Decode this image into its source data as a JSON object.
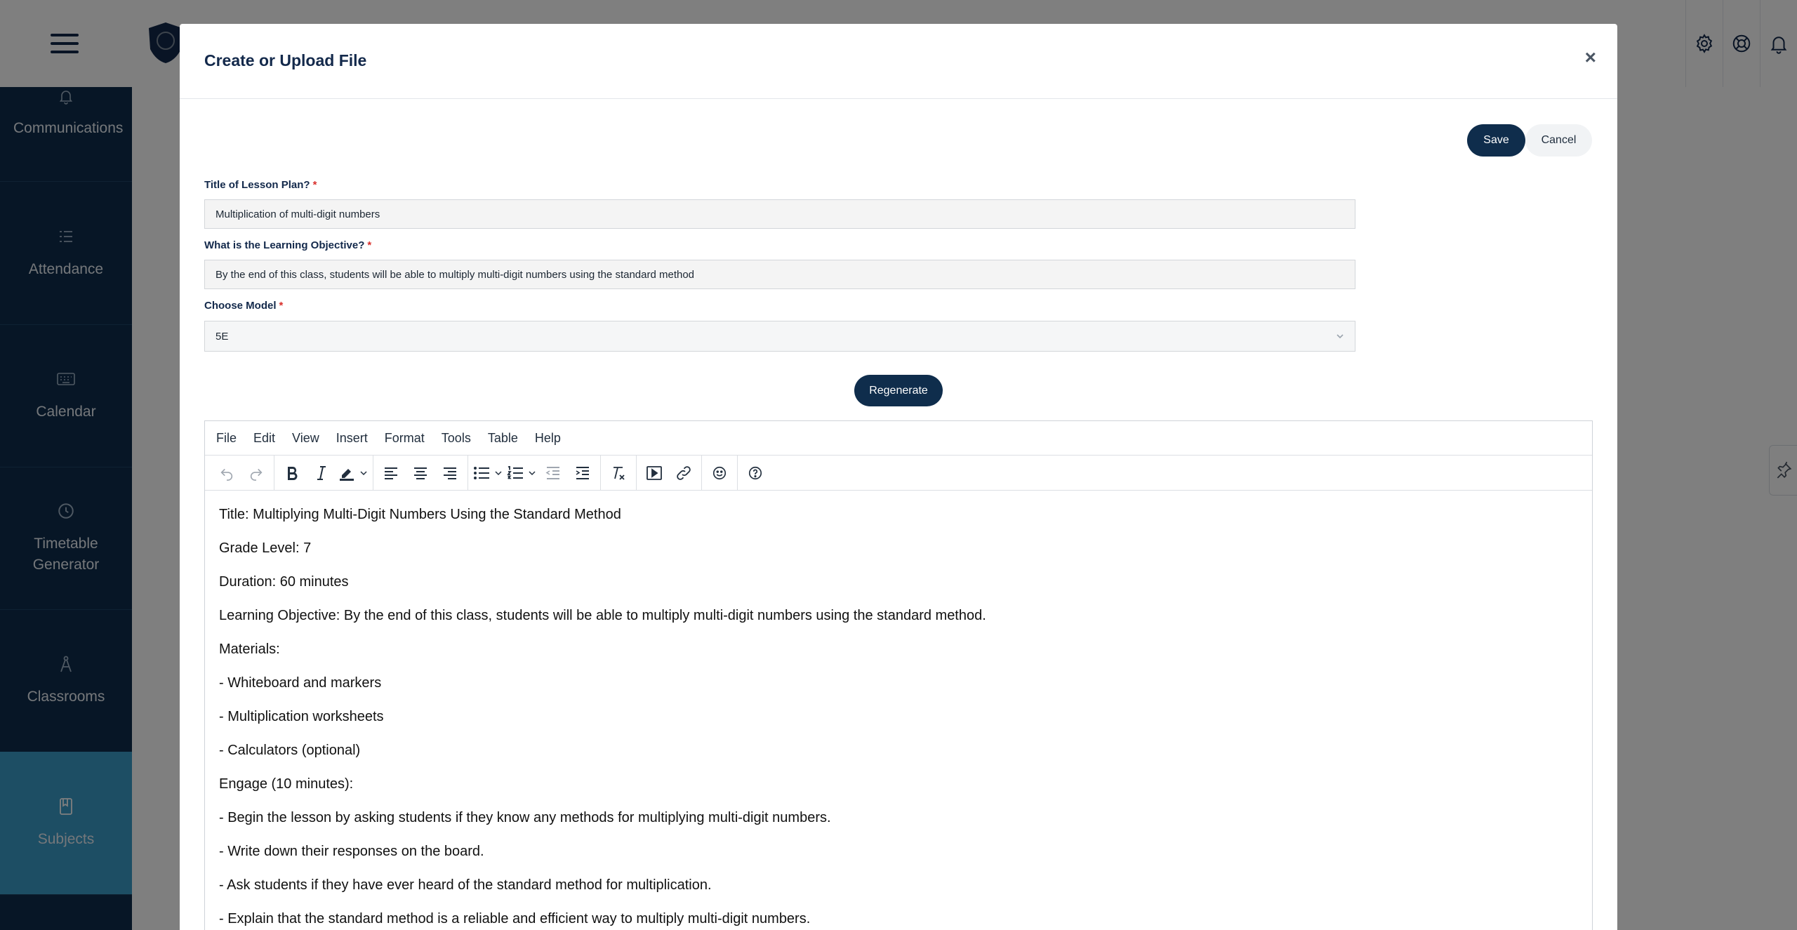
{
  "sidebar": {
    "items": [
      {
        "label": "Communications",
        "icon": "bell-icon"
      },
      {
        "label": "Attendance",
        "icon": "checklist-icon"
      },
      {
        "label": "Calendar",
        "icon": "keyboard-icon"
      },
      {
        "label": "Timetable Generator",
        "icon": "clock-icon"
      },
      {
        "label": "Classrooms",
        "icon": "compass-icon"
      },
      {
        "label": "Subjects",
        "icon": "book-icon",
        "active": true
      }
    ]
  },
  "topbar": {
    "icons": [
      "gear-icon",
      "lifebuoy-icon",
      "bell-icon"
    ]
  },
  "modal": {
    "title": "Create or Upload File",
    "close_label": "×",
    "save_label": "Save",
    "cancel_label": "Cancel",
    "fields": {
      "title_label": "Title of Lesson Plan?",
      "title_value": "Multiplication of multi-digit numbers",
      "objective_label": "What is the Learning Objective?",
      "objective_value": "By the end of this class, students will be able to multiply multi-digit numbers using the standard method",
      "model_label": "Choose Model",
      "model_value": "5E",
      "required_mark": "*"
    },
    "regenerate_label": "Regenerate"
  },
  "editor": {
    "menu": [
      "File",
      "Edit",
      "View",
      "Insert",
      "Format",
      "Tools",
      "Table",
      "Help"
    ],
    "content": [
      "Title: Multiplying Multi-Digit Numbers Using the Standard Method",
      "Grade Level: 7",
      "Duration: 60 minutes",
      "Learning Objective: By the end of this class, students will be able to multiply multi-digit numbers using the standard method.",
      "Materials:",
      "- Whiteboard and markers",
      "- Multiplication worksheets",
      "- Calculators (optional)",
      "Engage (10 minutes):",
      "- Begin the lesson by asking students if they know any methods for multiplying multi-digit numbers.",
      "- Write down their responses on the board.",
      "- Ask students if they have ever heard of the standard method for multiplication.",
      "- Explain that the standard method is a reliable and efficient way to multiply multi-digit numbers."
    ]
  },
  "colors": {
    "navy": "#0f2d4c",
    "active_sidebar": "#3a9cc9",
    "required": "#d9302c"
  }
}
